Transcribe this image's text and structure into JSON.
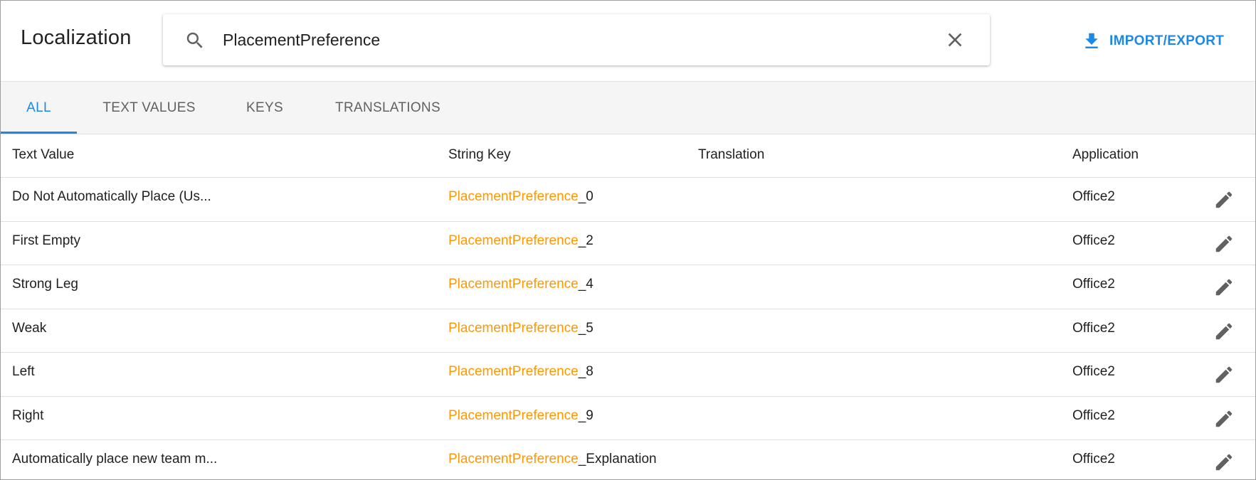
{
  "header": {
    "title": "Localization",
    "search": {
      "value": "PlacementPreference",
      "placeholder": ""
    },
    "import_export_label": "IMPORT/EXPORT"
  },
  "tabs": [
    {
      "label": "ALL",
      "active": true
    },
    {
      "label": "TEXT VALUES",
      "active": false
    },
    {
      "label": "KEYS",
      "active": false
    },
    {
      "label": "TRANSLATIONS",
      "active": false
    }
  ],
  "table": {
    "columns": [
      "Text Value",
      "String Key",
      "Translation",
      "Application"
    ],
    "rows": [
      {
        "text_value": "Do Not Automatically Place (Us...",
        "key_match": "PlacementPreference",
        "key_rest": "_0",
        "translation": "",
        "application": "Office2"
      },
      {
        "text_value": "First Empty",
        "key_match": "PlacementPreference",
        "key_rest": "_2",
        "translation": "",
        "application": "Office2"
      },
      {
        "text_value": "Strong Leg",
        "key_match": "PlacementPreference",
        "key_rest": "_4",
        "translation": "",
        "application": "Office2"
      },
      {
        "text_value": "Weak",
        "key_match": "PlacementPreference",
        "key_rest": "_5",
        "translation": "",
        "application": "Office2"
      },
      {
        "text_value": "Left",
        "key_match": "PlacementPreference",
        "key_rest": "_8",
        "translation": "",
        "application": "Office2"
      },
      {
        "text_value": "Right",
        "key_match": "PlacementPreference",
        "key_rest": "_9",
        "translation": "",
        "application": "Office2"
      },
      {
        "text_value": "Automatically place new team m...",
        "key_match": "PlacementPreference",
        "key_rest": "_Explanation",
        "translation": "",
        "application": "Office2"
      }
    ]
  },
  "icons": {
    "search": "search-icon",
    "clear": "close-icon",
    "import_export": "download-icon",
    "edit": "pencil-icon"
  },
  "colors": {
    "accent": "#1e88e5",
    "key_highlight": "#ff9800",
    "icon_gray": "#616161"
  }
}
